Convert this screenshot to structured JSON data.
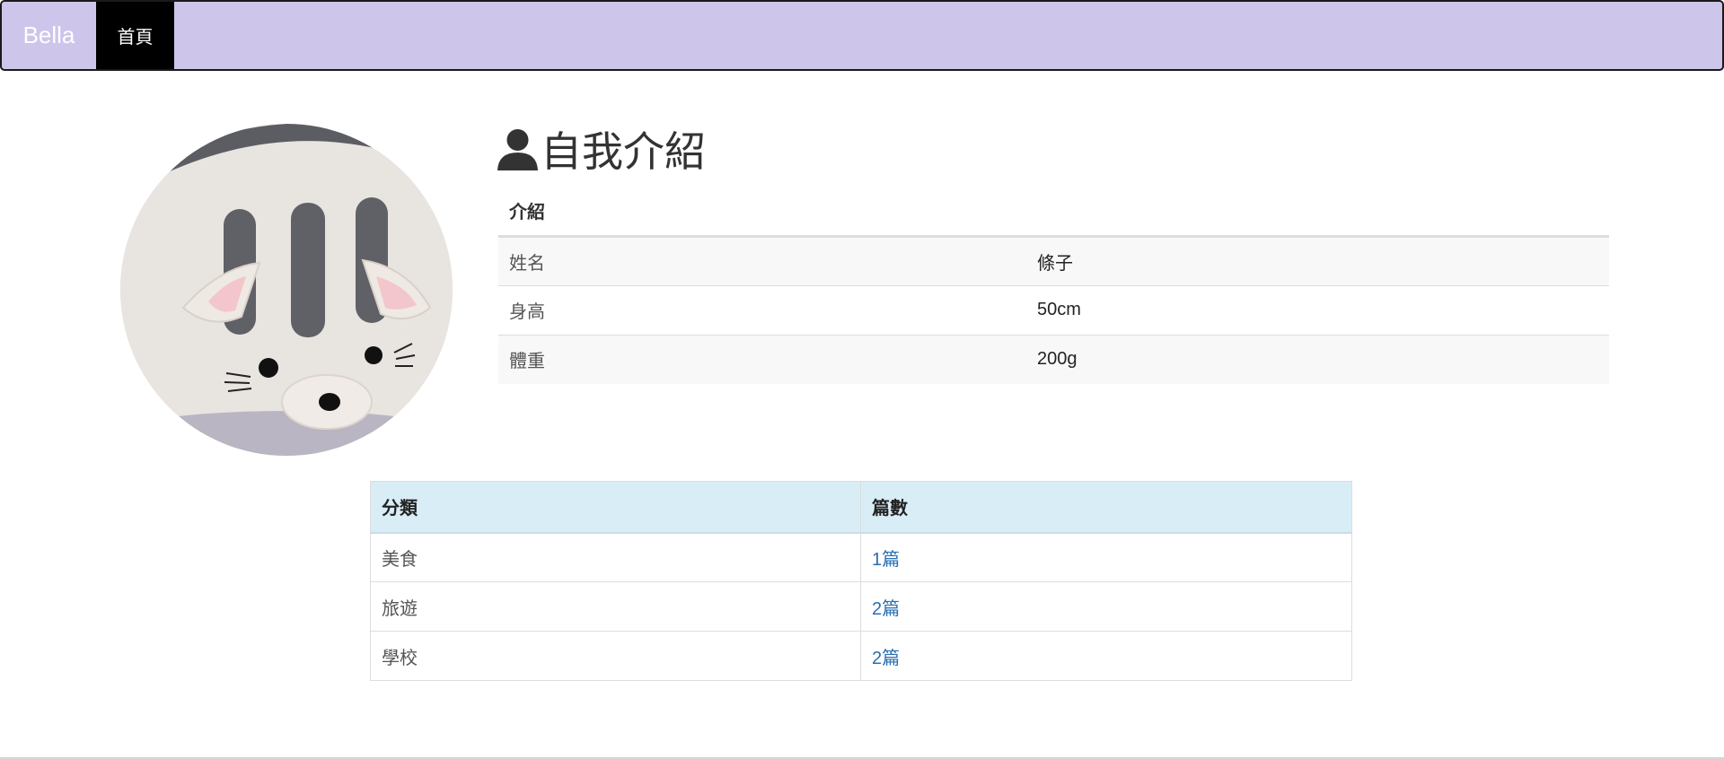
{
  "navbar": {
    "brand": "Bella",
    "links": [
      {
        "label": "首頁"
      }
    ]
  },
  "intro": {
    "title": "自我介紹",
    "table_header": "介紹",
    "rows": [
      {
        "key": "姓名",
        "value": "條子"
      },
      {
        "key": "身高",
        "value": "50cm"
      },
      {
        "key": "體重",
        "value": "200g"
      }
    ]
  },
  "categories": {
    "headers": [
      "分類",
      "篇數"
    ],
    "rows": [
      {
        "name": "美食",
        "count": "1篇"
      },
      {
        "name": "旅遊",
        "count": "2篇"
      },
      {
        "name": "學校",
        "count": "2篇"
      }
    ]
  },
  "colors": {
    "navbar_bg": "#cdc5ea",
    "active_nav": "#000000",
    "table_header_bg": "#d9edf7",
    "link": "#2a6fb0"
  },
  "icons": {
    "title_icon": "user-icon",
    "avatar": "cat-plush-avatar"
  }
}
